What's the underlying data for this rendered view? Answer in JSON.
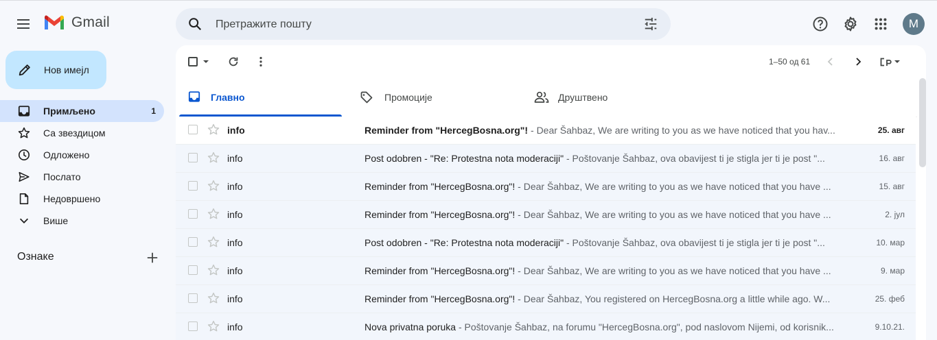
{
  "app": {
    "name": "Gmail"
  },
  "search": {
    "placeholder": "Претражите пошту"
  },
  "account": {
    "avatar_letter": "M"
  },
  "compose": {
    "label": "Нов имејл"
  },
  "sidebar": {
    "items": [
      {
        "label": "Примљено",
        "count": "1",
        "icon": "inbox-icon"
      },
      {
        "label": "Са звездицом",
        "count": "",
        "icon": "star-icon"
      },
      {
        "label": "Одложено",
        "count": "",
        "icon": "clock-icon"
      },
      {
        "label": "Послато",
        "count": "",
        "icon": "send-icon"
      },
      {
        "label": "Недовршено",
        "count": "",
        "icon": "draft-icon"
      },
      {
        "label": "Више",
        "count": "",
        "icon": "chevron-down-icon"
      }
    ],
    "labels_title": "Ознаке"
  },
  "toolbar": {
    "range": "1–50 од 61"
  },
  "tabs": [
    {
      "label": "Главно",
      "icon": "inbox-icon"
    },
    {
      "label": "Промоције",
      "icon": "tag-icon"
    },
    {
      "label": "Друштвено",
      "icon": "people-icon"
    }
  ],
  "emails": [
    {
      "sender": "info",
      "subject": "Reminder from \"HercegBosna.org\"!",
      "snippet": "Dear Šahbaz, We are writing to you as we have noticed that you hav...",
      "date": "25. авг"
    },
    {
      "sender": "info",
      "subject": "Post odobren - \"Re: Protestna nota moderaciji\"",
      "snippet": "Poštovanje Šahbaz, ova obavijest ti je stigla jer ti je post \"...",
      "date": "16. авг"
    },
    {
      "sender": "info",
      "subject": "Reminder from \"HercegBosna.org\"!",
      "snippet": "Dear Šahbaz, We are writing to you as we have noticed that you have ...",
      "date": "15. авг"
    },
    {
      "sender": "info",
      "subject": "Reminder from \"HercegBosna.org\"!",
      "snippet": "Dear Šahbaz, We are writing to you as we have noticed that you have ...",
      "date": "2. јул"
    },
    {
      "sender": "info",
      "subject": "Post odobren - \"Re: Protestna nota moderaciji\"",
      "snippet": "Poštovanje Šahbaz, ova obavijest ti je stigla jer ti je post \"...",
      "date": "10. мар"
    },
    {
      "sender": "info",
      "subject": "Reminder from \"HercegBosna.org\"!",
      "snippet": "Dear Šahbaz, We are writing to you as we have noticed that you have ...",
      "date": "9. мар"
    },
    {
      "sender": "info",
      "subject": "Reminder from \"HercegBosna.org\"!",
      "snippet": "Dear Šahbaz, You registered on HercegBosna.org a little while ago. W...",
      "date": "25. феб"
    },
    {
      "sender": "info",
      "subject": "Nova privatna poruka",
      "snippet": "Poštovanje Šahbaz, na forumu \"HercegBosna.org\", pod naslovom Nijemi, od korisnik...",
      "date": "9.10.21."
    }
  ],
  "unread_rows": [
    0
  ],
  "colors": {
    "accent": "#0b57d0",
    "compose_bg": "#c2e7ff",
    "active_nav_bg": "#d3e3fd",
    "app_bg": "#f6f8fc"
  }
}
